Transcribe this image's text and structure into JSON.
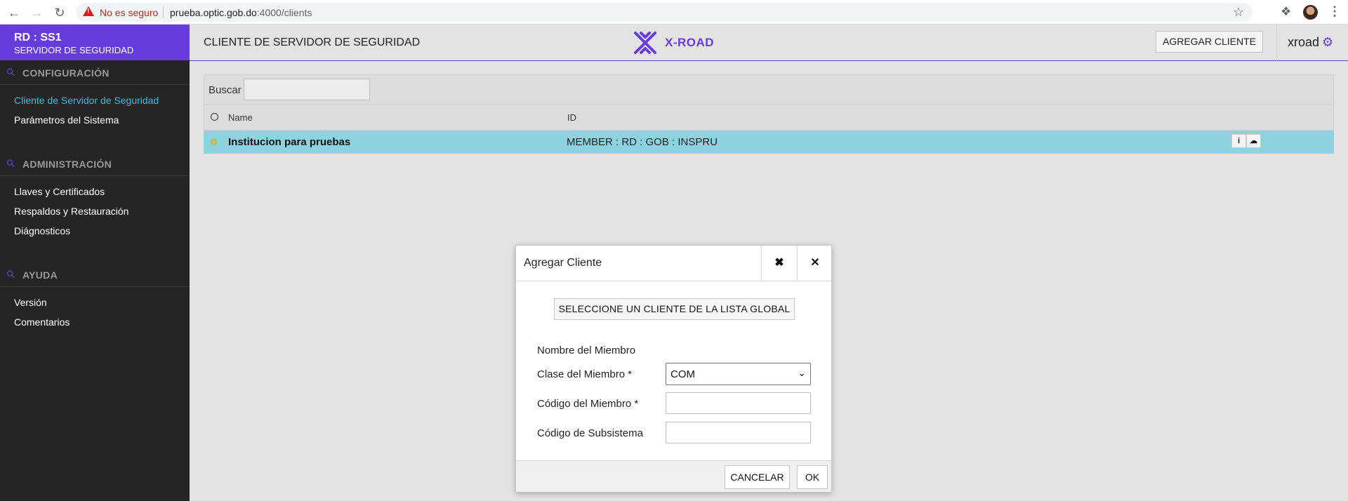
{
  "browser": {
    "security_label": "No es seguro",
    "url_host": "prueba.optic.gob.do",
    "url_path": ":4000/clients"
  },
  "sidebar": {
    "instance": "RD : SS1",
    "subtitle": "SERVIDOR DE SEGURIDAD",
    "sections": [
      {
        "label": "CONFIGURACIÓN",
        "items": [
          "Cliente de Servidor de Seguridad",
          "Parámetros del Sistema"
        ]
      },
      {
        "label": "ADMINISTRACIÓN",
        "items": [
          "Llaves y Certificados",
          "Respaldos y Restauración",
          "Diágnosticos"
        ]
      },
      {
        "label": "AYUDA",
        "items": [
          "Versión",
          "Comentarios"
        ]
      }
    ],
    "active_item": "Cliente de Servidor de Seguridad"
  },
  "header": {
    "title": "CLIENTE DE SERVIDOR DE SEGURIDAD",
    "logo_text": "X-ROAD",
    "add_client_label": "AGREGAR CLIENTE",
    "username": "xroad"
  },
  "search": {
    "label": "Buscar",
    "value": ""
  },
  "table": {
    "columns": [
      "Name",
      "ID"
    ],
    "rows": [
      {
        "name": "Institucion para pruebas",
        "id": "MEMBER : RD : GOB : INSPRU"
      }
    ]
  },
  "dialog": {
    "title": "Agregar Cliente",
    "global_list_button": "SELECCIONE UN CLIENTE DE LA LISTA GLOBAL",
    "member_name_label": "Nombre del Miembro",
    "member_class_label": "Clase del Miembro *",
    "member_class_value": "COM",
    "member_code_label": "Código del Miembro *",
    "member_code_value": "",
    "subsystem_code_label": "Código de Subsistema",
    "subsystem_code_value": "",
    "cancel_label": "CANCELAR",
    "ok_label": "OK"
  },
  "colors": {
    "brand": "#663cdc",
    "sidebar_bg": "#252525",
    "active_link": "#33bfe0",
    "selected_row": "#8cd3df"
  },
  "icons": [
    "back-arrow-icon",
    "forward-arrow-icon",
    "reload-icon",
    "warning-icon",
    "star-icon",
    "extensions-icon",
    "kebab-menu-icon",
    "wrench-icon",
    "gear-icon",
    "info-icon",
    "cloud-icon",
    "maximize-icon",
    "close-icon",
    "chevron-down-icon"
  ]
}
